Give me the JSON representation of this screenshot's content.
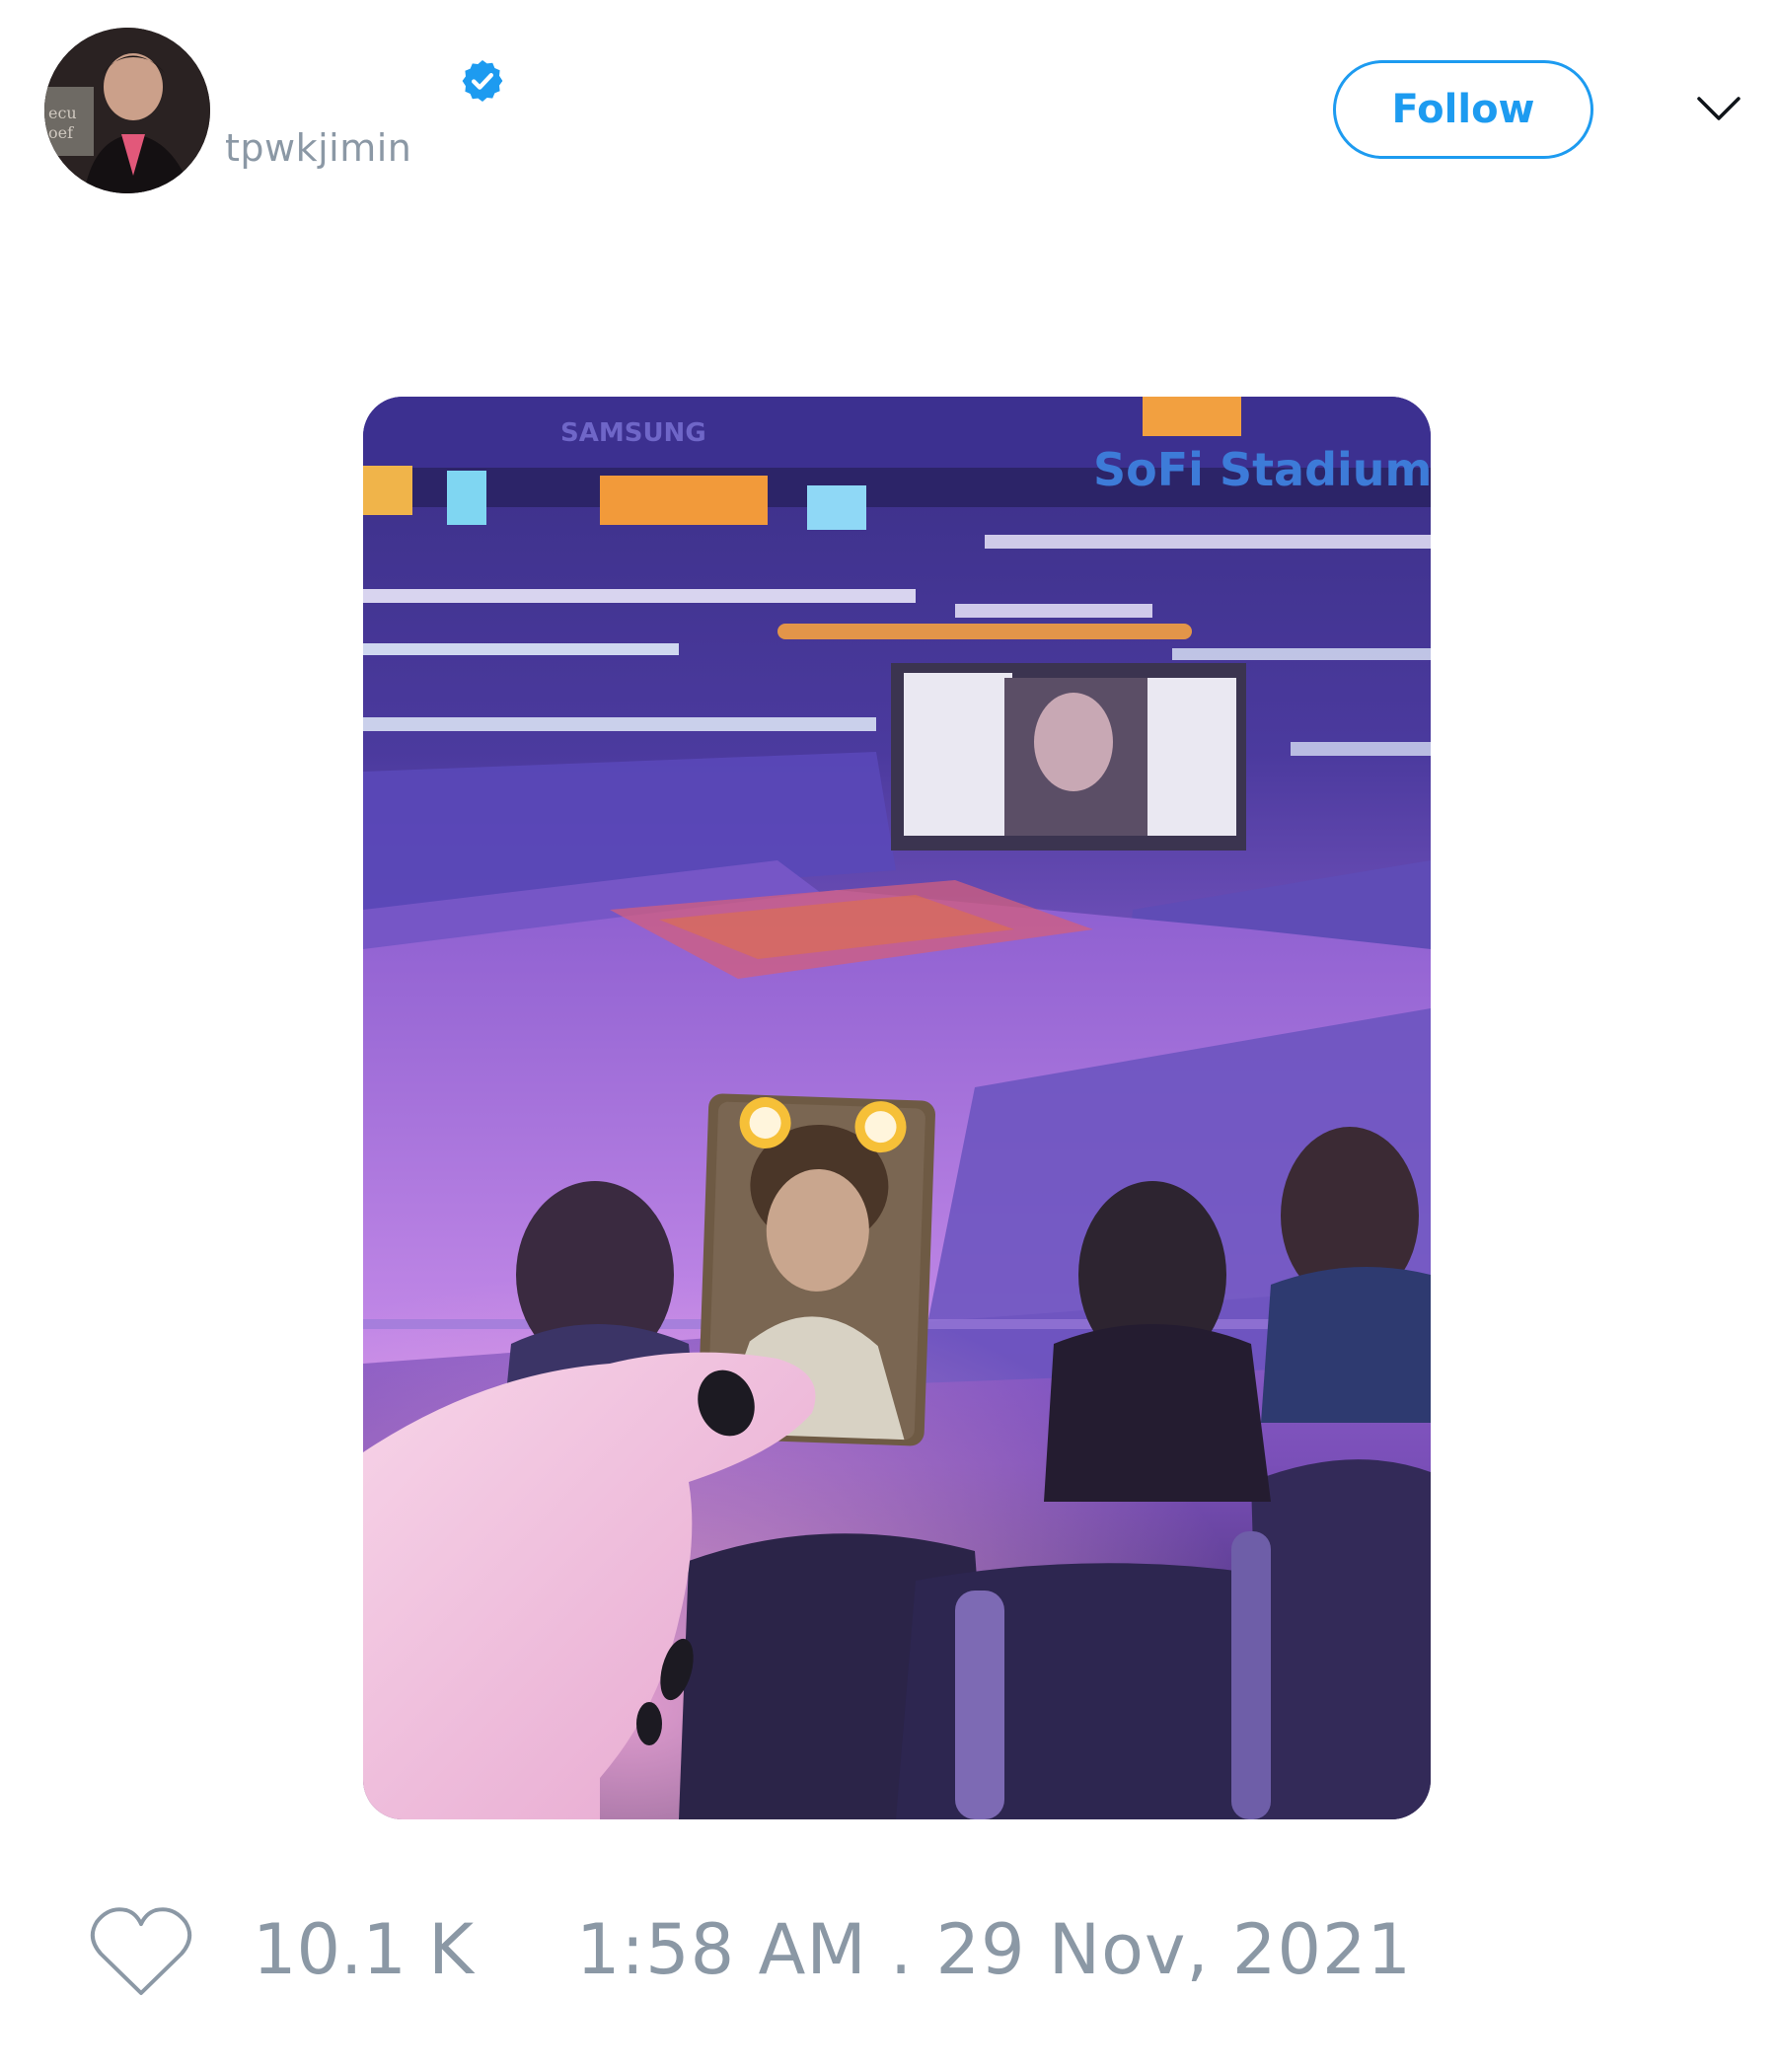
{
  "author": {
    "display_name": "",
    "handle": "tpwkjimin",
    "avatar_icon": "user-avatar",
    "verified_icon": "verified-badge-icon",
    "verified_color": "#1d9bf0"
  },
  "header": {
    "follow_label": "Follow",
    "menu_icon": "chevron-down-icon"
  },
  "media": {
    "alt": "",
    "type": "photo"
  },
  "footer": {
    "like_icon": "heart-outline-icon",
    "like_count": "10.1 K",
    "timestamp": "1:58 AM . 29 Nov, 2021"
  },
  "colors": {
    "accent": "#1d9bf0",
    "muted_text": "#8b98a5",
    "background": "#ffffff"
  }
}
